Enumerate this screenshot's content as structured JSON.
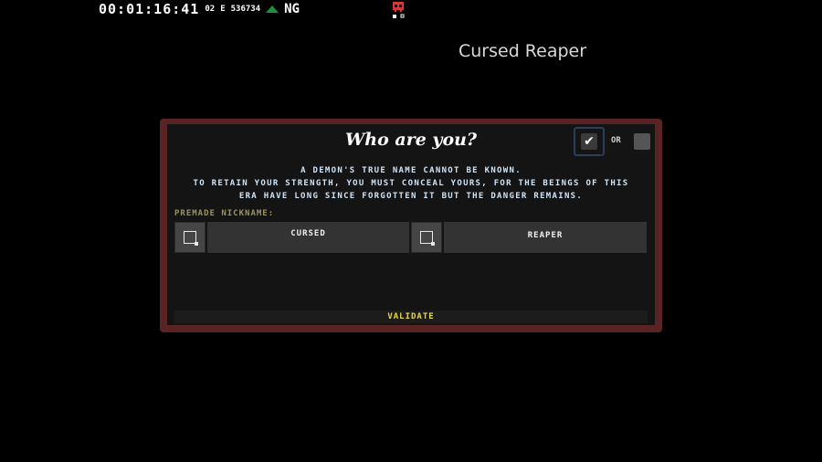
{
  "hud": {
    "timer": "00:01:16:41",
    "level": "02",
    "currency_label": "E",
    "currency_value": "536734",
    "mode": "NG",
    "colors": {
      "arrow": "#1f8f3a",
      "skull": "#d23a3a"
    }
  },
  "player_name": "Cursed Reaper",
  "dialog": {
    "title": "Who are you?",
    "custom_checkbox_icon": "check-icon",
    "or_label": "OR",
    "description": [
      "A DEMON'S TRUE NAME CANNOT BE KNOWN.",
      "TO RETAIN YOUR STRENGTH, YOU MUST CONCEAL YOURS, FOR THE BEINGS OF THIS",
      "ERA HAVE LONG SINCE FORGOTTEN IT BUT THE DANGER REMAINS."
    ],
    "premade_label": "PREMADE NICKNAME:",
    "first_name": "CURSED",
    "second_name": "REAPER",
    "validate_label": "VALIDATE",
    "colors": {
      "frame": "#5a2424",
      "validate": "#e8d84a",
      "description": "#cfe3f7"
    }
  }
}
